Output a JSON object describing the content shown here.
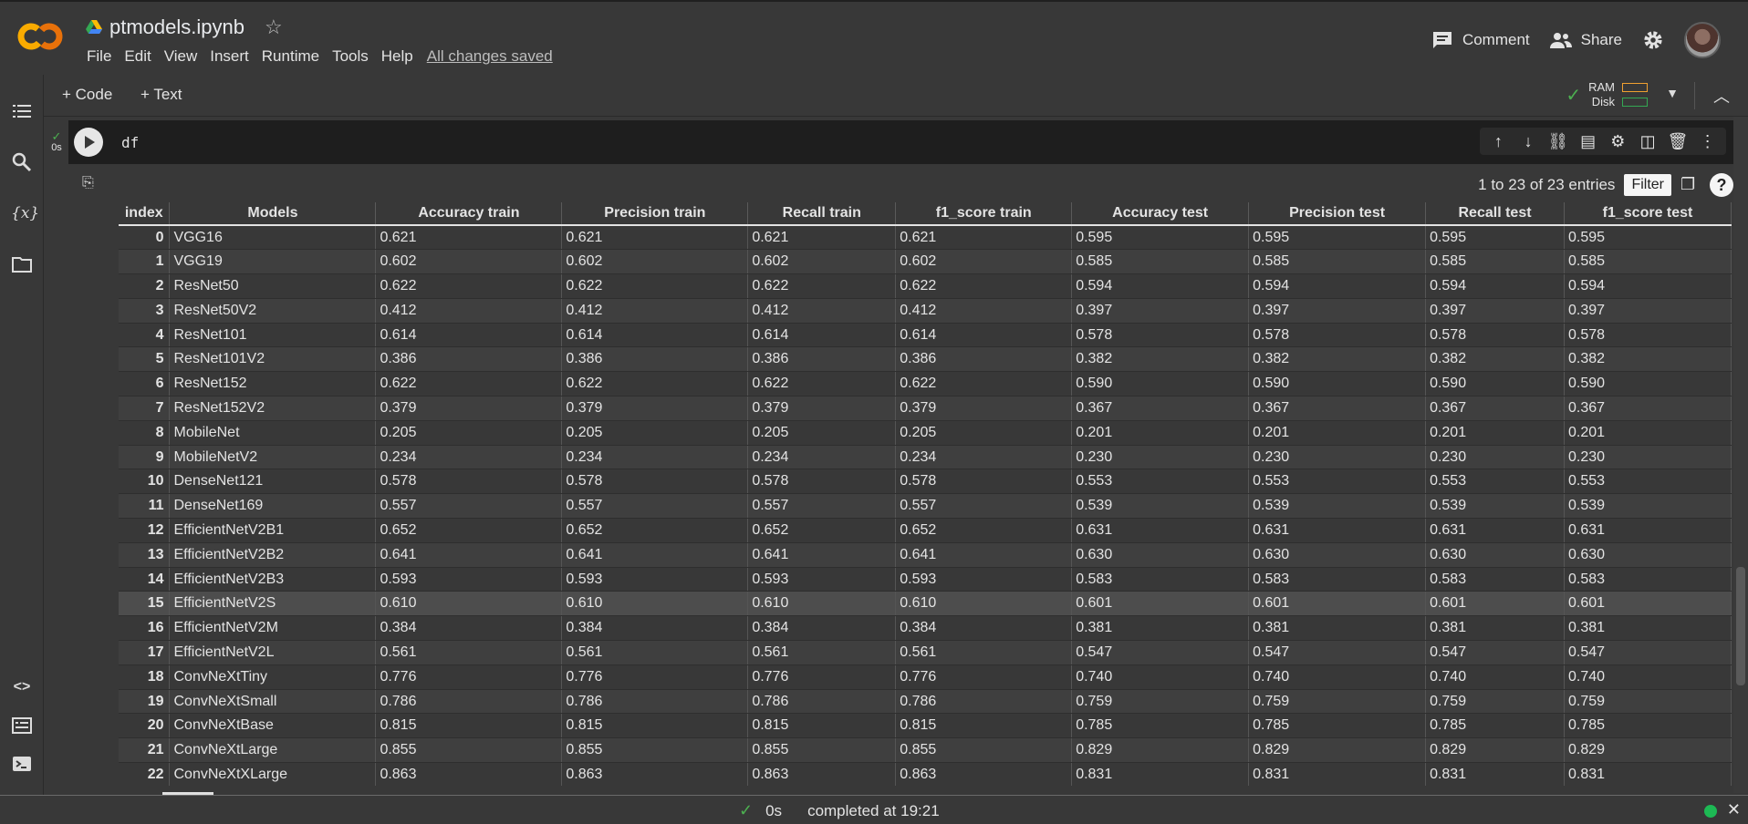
{
  "header": {
    "title": "ptmodels.ipynb",
    "menu": [
      "File",
      "Edit",
      "View",
      "Insert",
      "Runtime",
      "Tools",
      "Help"
    ],
    "saved_status": "All changes saved",
    "comment_label": "Comment",
    "share_label": "Share"
  },
  "toolbar": {
    "code_label": "+ Code",
    "text_label": "+ Text",
    "ram_label": "RAM",
    "disk_label": "Disk"
  },
  "cell": {
    "exec_time": "0s",
    "code": "df"
  },
  "output": {
    "entries_text": "1 to 23 of 23 entries",
    "filter_label": "Filter",
    "help_label": "?"
  },
  "table": {
    "headers": [
      "index",
      "Models",
      "Accuracy train",
      "Precision train",
      "Recall train",
      "f1_score train",
      "Accuracy test",
      "Precision test",
      "Recall test",
      "f1_score test"
    ],
    "rows": [
      [
        "0",
        "VGG16",
        "0.621",
        "0.621",
        "0.621",
        "0.621",
        "0.595",
        "0.595",
        "0.595",
        "0.595"
      ],
      [
        "1",
        "VGG19",
        "0.602",
        "0.602",
        "0.602",
        "0.602",
        "0.585",
        "0.585",
        "0.585",
        "0.585"
      ],
      [
        "2",
        "ResNet50",
        "0.622",
        "0.622",
        "0.622",
        "0.622",
        "0.594",
        "0.594",
        "0.594",
        "0.594"
      ],
      [
        "3",
        "ResNet50V2",
        "0.412",
        "0.412",
        "0.412",
        "0.412",
        "0.397",
        "0.397",
        "0.397",
        "0.397"
      ],
      [
        "4",
        "ResNet101",
        "0.614",
        "0.614",
        "0.614",
        "0.614",
        "0.578",
        "0.578",
        "0.578",
        "0.578"
      ],
      [
        "5",
        "ResNet101V2",
        "0.386",
        "0.386",
        "0.386",
        "0.386",
        "0.382",
        "0.382",
        "0.382",
        "0.382"
      ],
      [
        "6",
        "ResNet152",
        "0.622",
        "0.622",
        "0.622",
        "0.622",
        "0.590",
        "0.590",
        "0.590",
        "0.590"
      ],
      [
        "7",
        "ResNet152V2",
        "0.379",
        "0.379",
        "0.379",
        "0.379",
        "0.367",
        "0.367",
        "0.367",
        "0.367"
      ],
      [
        "8",
        "MobileNet",
        "0.205",
        "0.205",
        "0.205",
        "0.205",
        "0.201",
        "0.201",
        "0.201",
        "0.201"
      ],
      [
        "9",
        "MobileNetV2",
        "0.234",
        "0.234",
        "0.234",
        "0.234",
        "0.230",
        "0.230",
        "0.230",
        "0.230"
      ],
      [
        "10",
        "DenseNet121",
        "0.578",
        "0.578",
        "0.578",
        "0.578",
        "0.553",
        "0.553",
        "0.553",
        "0.553"
      ],
      [
        "11",
        "DenseNet169",
        "0.557",
        "0.557",
        "0.557",
        "0.557",
        "0.539",
        "0.539",
        "0.539",
        "0.539"
      ],
      [
        "12",
        "EfficientNetV2B1",
        "0.652",
        "0.652",
        "0.652",
        "0.652",
        "0.631",
        "0.631",
        "0.631",
        "0.631"
      ],
      [
        "13",
        "EfficientNetV2B2",
        "0.641",
        "0.641",
        "0.641",
        "0.641",
        "0.630",
        "0.630",
        "0.630",
        "0.630"
      ],
      [
        "14",
        "EfficientNetV2B3",
        "0.593",
        "0.593",
        "0.593",
        "0.593",
        "0.583",
        "0.583",
        "0.583",
        "0.583"
      ],
      [
        "15",
        "EfficientNetV2S",
        "0.610",
        "0.610",
        "0.610",
        "0.610",
        "0.601",
        "0.601",
        "0.601",
        "0.601"
      ],
      [
        "16",
        "EfficientNetV2M",
        "0.384",
        "0.384",
        "0.384",
        "0.384",
        "0.381",
        "0.381",
        "0.381",
        "0.381"
      ],
      [
        "17",
        "EfficientNetV2L",
        "0.561",
        "0.561",
        "0.561",
        "0.561",
        "0.547",
        "0.547",
        "0.547",
        "0.547"
      ],
      [
        "18",
        "ConvNeXtTiny",
        "0.776",
        "0.776",
        "0.776",
        "0.776",
        "0.740",
        "0.740",
        "0.740",
        "0.740"
      ],
      [
        "19",
        "ConvNeXtSmall",
        "0.786",
        "0.786",
        "0.786",
        "0.786",
        "0.759",
        "0.759",
        "0.759",
        "0.759"
      ],
      [
        "20",
        "ConvNeXtBase",
        "0.815",
        "0.815",
        "0.815",
        "0.815",
        "0.785",
        "0.785",
        "0.785",
        "0.785"
      ],
      [
        "21",
        "ConvNeXtLarge",
        "0.855",
        "0.855",
        "0.855",
        "0.855",
        "0.829",
        "0.829",
        "0.829",
        "0.829"
      ],
      [
        "22",
        "ConvNeXtXLarge",
        "0.863",
        "0.863",
        "0.863",
        "0.863",
        "0.831",
        "0.831",
        "0.831",
        "0.831"
      ]
    ],
    "highlighted_row": 15
  },
  "statusbar": {
    "time": "0s",
    "completed_text": "completed at 19:21"
  },
  "colors": {
    "ram_bar": "#f0a030",
    "disk_bar": "#34a853",
    "status_ok": "#4caf50"
  },
  "icons": [
    "colab-logo",
    "drive-icon",
    "star-icon",
    "comment-icon",
    "share-icon",
    "gear-icon",
    "toc-icon",
    "search-icon",
    "variables-icon",
    "folder-icon",
    "code-snippets-icon",
    "command-palette-icon",
    "terminal-icon"
  ]
}
